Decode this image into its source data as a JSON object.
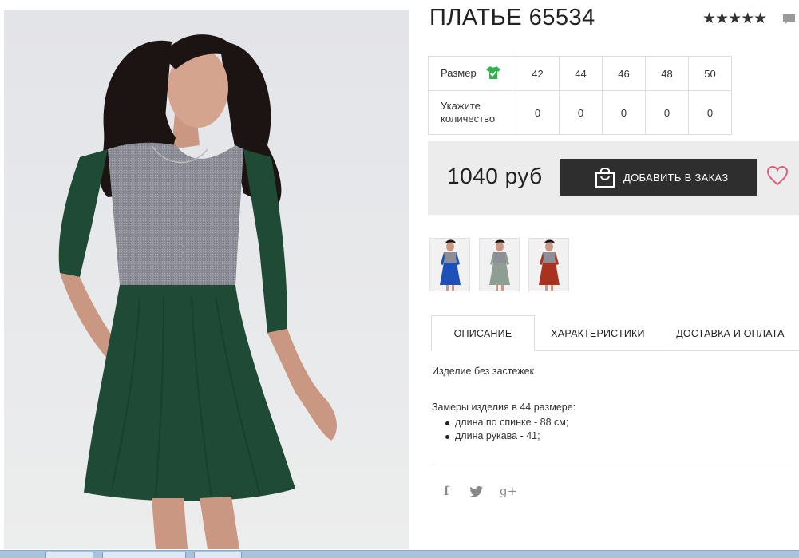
{
  "product": {
    "title": "ПЛАТЬЕ 65534",
    "rating_stars": "★★★★★",
    "rating_value": 5
  },
  "size_table": {
    "size_label": "Размер",
    "quantity_label_line1": "Укажите",
    "quantity_label_line2": "количество",
    "sizes": [
      "42",
      "44",
      "46",
      "48",
      "50"
    ],
    "quantities": [
      "0",
      "0",
      "0",
      "0",
      "0"
    ]
  },
  "price": {
    "value": "1040 руб",
    "add_button_label": "ДОБАВИТЬ В ЗАКАЗ"
  },
  "thumbnails": [
    {
      "name": "thumb-blue",
      "dress_color": "#1f4fb8"
    },
    {
      "name": "thumb-mint",
      "dress_color": "#8e9e92"
    },
    {
      "name": "thumb-red",
      "dress_color": "#a8321f"
    }
  ],
  "tabs": [
    {
      "label": "ОПИСАНИЕ",
      "active": true
    },
    {
      "label": "ХАРАКТЕРИСТИКИ",
      "active": false
    },
    {
      "label": "ДОСТАВКА И ОПЛАТА",
      "active": false
    }
  ],
  "description": {
    "line1": "Изделие без застежек",
    "measures_title": "Замеры изделия в 44 размере:",
    "bullets": [
      "длина по спинке - 88 см;",
      "длина рукава - 41;"
    ]
  },
  "social": {
    "facebook": "f",
    "twitter": "twitter-icon",
    "google_plus": "g+"
  },
  "colors": {
    "dark_button": "#2e2e2e",
    "price_bg": "#ececec",
    "heart": "#d9617a",
    "shirt_icon": "#2db34a",
    "dress_green": "#1f4a35",
    "top_gray": "#8d8e96"
  }
}
